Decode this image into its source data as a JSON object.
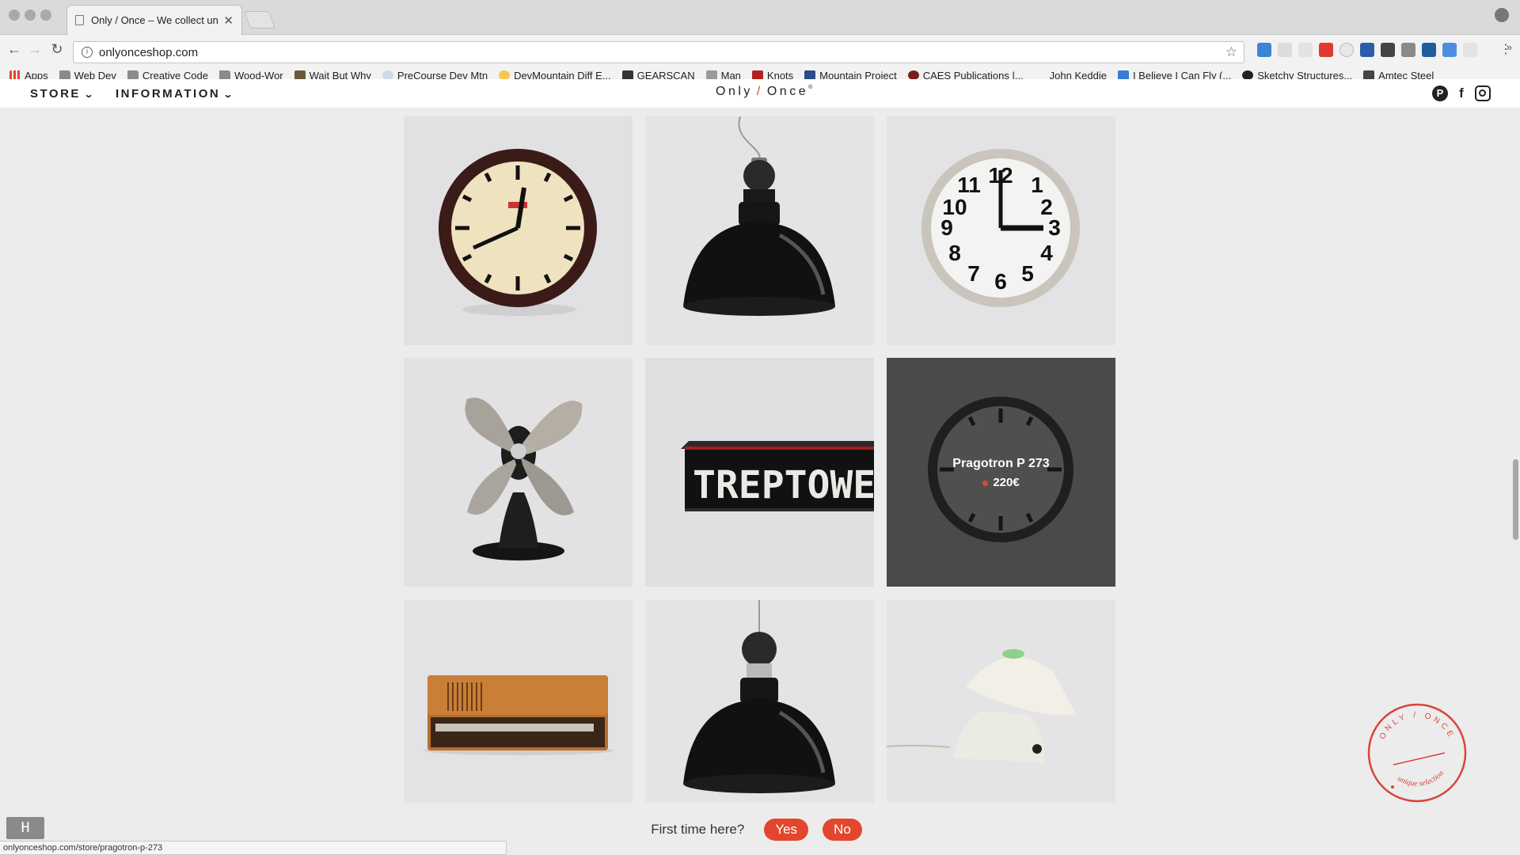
{
  "browser": {
    "tab_title": "Only / Once – We collect uniq",
    "url": "onlyonceshop.com",
    "status_url": "onlyonceshop.com/store/pragotron-p-273",
    "bookmarks": [
      "Apps",
      "Web Dev",
      "Creative Code",
      "Wood-Wor",
      "Wait But Why",
      "PreCourse Dev Mtn",
      "DevMountain Diff E...",
      "GEARSCAN",
      "Man",
      "Knots",
      "Mountain Project",
      "CAES Publications |...",
      "John Keddie",
      "I Believe I Can Fly (...",
      "Sketchy Structures...",
      "Amtec Steel"
    ],
    "bookmarks_more": "»"
  },
  "site": {
    "menu": {
      "store": "STORE",
      "information": "INFORMATION"
    },
    "logo": {
      "left": "Only",
      "slash": "/",
      "right": "Once",
      "mark": "®"
    },
    "social": {
      "pinterest": "P",
      "facebook": "f"
    }
  },
  "products": [
    {
      "kind": "wall-clock-dark"
    },
    {
      "kind": "pendant-lamp"
    },
    {
      "kind": "wall-clock-white"
    },
    {
      "kind": "desk-fan"
    },
    {
      "kind": "sign-box",
      "sign_text": "TREPTOWER"
    },
    {
      "kind": "hovered-clock",
      "name": "Pragotron P 273",
      "price": "220€"
    },
    {
      "kind": "radio"
    },
    {
      "kind": "pendant-lamp"
    },
    {
      "kind": "wall-lamp"
    }
  ],
  "stamp": {
    "top": "ONLY / ONCE",
    "bottom": "unique selection"
  },
  "first_time": {
    "question": "First time here?",
    "yes": "Yes",
    "no": "No"
  },
  "colors": {
    "accent": "#e2472e",
    "page_bg": "#ececec"
  },
  "icons": [
    "back-arrow-icon",
    "forward-arrow-icon",
    "reload-icon",
    "info-icon",
    "bookmark-star-icon",
    "pinterest-icon",
    "facebook-icon",
    "instagram-icon",
    "chevron-down-icon"
  ]
}
